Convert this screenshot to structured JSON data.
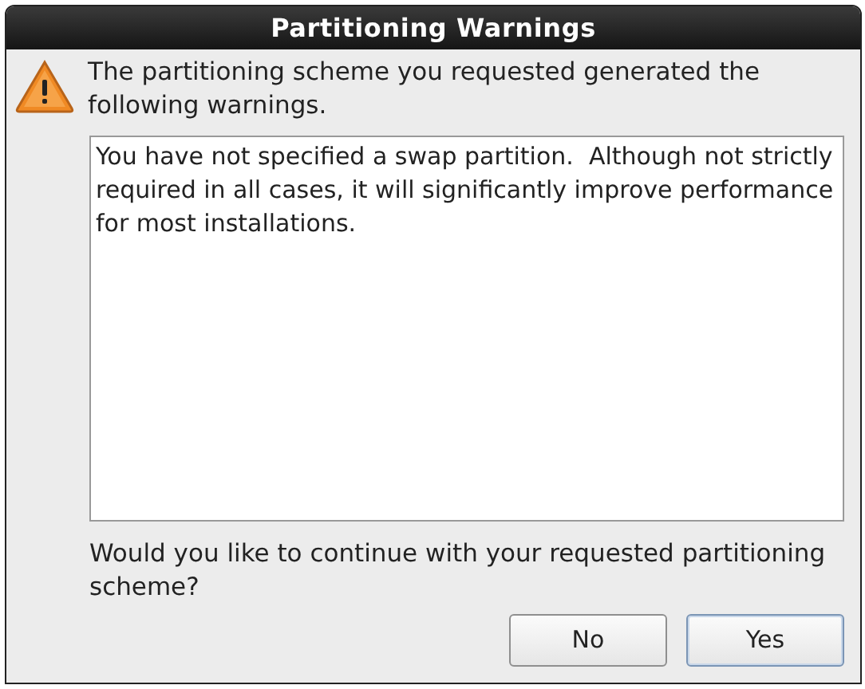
{
  "window": {
    "title": "Partitioning Warnings"
  },
  "message": "The partitioning scheme you requested generated the following warnings.",
  "warnings_text": "You have not specified a swap partition.  Although not strictly required in all cases, it will significantly improve performance for most installations.",
  "question": "Would you like to continue with your requested partitioning scheme?",
  "buttons": [
    {
      "label": "No",
      "focused": false
    },
    {
      "label": "Yes",
      "focused": true
    }
  ]
}
